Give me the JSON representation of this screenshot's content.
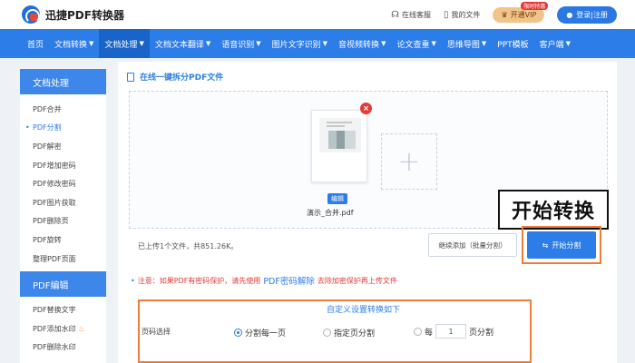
{
  "header": {
    "app_name": "迅捷PDF转换器",
    "online_service": "在线客服",
    "my_files": "我的文件",
    "vip_label": "开通VIP",
    "vip_badge": "限时特惠",
    "login": "登录|注册"
  },
  "nav": {
    "items": [
      {
        "label": "首页",
        "caret": false
      },
      {
        "label": "文档转换",
        "caret": true
      },
      {
        "label": "文档处理",
        "caret": true,
        "active": true
      },
      {
        "label": "文档文本翻译",
        "caret": true
      },
      {
        "label": "语音识别",
        "caret": true
      },
      {
        "label": "图片文字识别",
        "caret": true
      },
      {
        "label": "音视频转换",
        "caret": true
      },
      {
        "label": "论文查重",
        "caret": true
      },
      {
        "label": "思维导图",
        "caret": true
      },
      {
        "label": "PPT模板",
        "caret": false
      },
      {
        "label": "客户端",
        "caret": true
      }
    ]
  },
  "sidebar": {
    "section1_title": "文档处理",
    "section1_items": [
      "PDF合并",
      "PDF分割",
      "PDF解密",
      "PDF增加密码",
      "PDF修改密码",
      "PDF图片获取",
      "PDF删除页",
      "PDF旋转",
      "整理PDF页面"
    ],
    "active_item": "PDF分割",
    "section2_title": "PDF编辑",
    "section2_items": [
      "PDF替换文字",
      "PDF添加水印",
      "PDF删除水印"
    ]
  },
  "main": {
    "title": "在线一键拆分PDF文件",
    "file": {
      "edit_tag": "编辑",
      "name": "演示_合并.pdf"
    },
    "callout": "开始转换",
    "upload_status": "已上传1个文件，共851.26K。",
    "continue_button": "继续添加（批量分割）",
    "start_button": "开始分割",
    "notice_prefix": "注意：如果PDF有密码保护，请先使用",
    "notice_link": "PDF密码解除",
    "notice_suffix": "去除加密保护再上传文件",
    "settings": {
      "title": "自定义设置转换如下",
      "row_label": "页码选择",
      "opt1": "分割每一页",
      "opt2": "指定页分割",
      "opt3_prefix": "每",
      "opt3_value": "1",
      "opt3_suffix": "页分割"
    }
  },
  "colors": {
    "primary": "#2d7de8",
    "highlight": "#f07c3a",
    "alert": "#e53935"
  }
}
